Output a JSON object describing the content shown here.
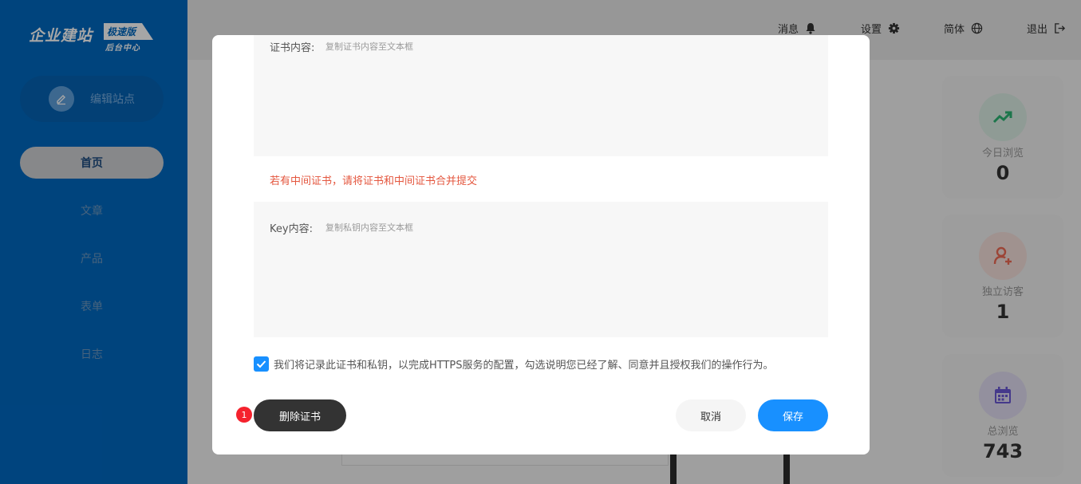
{
  "sidebar": {
    "logo_main": "企业建站",
    "logo_badge": "极速版",
    "logo_sub": "后台中心",
    "edit_site_label": "编辑站点",
    "items": [
      {
        "label": "首页",
        "active": true
      },
      {
        "label": "文章"
      },
      {
        "label": "产品"
      },
      {
        "label": "表单"
      },
      {
        "label": "日志"
      }
    ]
  },
  "header": {
    "messages_label": "消息",
    "settings_label": "设置",
    "language_label": "简体",
    "logout_label": "退出"
  },
  "stats": [
    {
      "label": "今日浏览",
      "value": "0",
      "icon": "trend-up-icon",
      "color": "#2bb673"
    },
    {
      "label": "独立访客",
      "value": "1",
      "icon": "user-add-icon",
      "color": "#f06a55"
    },
    {
      "label": "总浏览",
      "value": "743",
      "icon": "calendar-icon",
      "color": "#6a58d6"
    }
  ],
  "modal": {
    "cert_label": "证书内容:",
    "cert_placeholder": "复制证书内容至文本框",
    "warning": "若有中间证书，请将证书和中间证书合并提交",
    "key_label": "Key内容:",
    "key_placeholder": "复制私钥内容至文本框",
    "agree_checked": true,
    "agree_text": "我们将记录此证书和私钥，以完成HTTPS服务的配置，勾选说明您已经了解、同意并且授权我们的操作行为。",
    "delete_label": "删除证书",
    "delete_badge": "1",
    "cancel_label": "取消",
    "save_label": "保存"
  },
  "colors": {
    "sidebar_bg": "#0069c1",
    "primary": "#1890ff",
    "warning": "#e4573f",
    "dark_button": "#333333"
  }
}
